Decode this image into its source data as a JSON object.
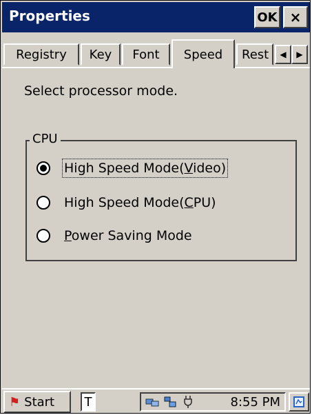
{
  "window": {
    "title": "Properties",
    "ok_label": "OK",
    "close_label": "×"
  },
  "tabs": [
    {
      "label": "Registry"
    },
    {
      "label": "Key"
    },
    {
      "label": "Font"
    },
    {
      "label": "Speed",
      "active": true
    },
    {
      "label": "Rest"
    }
  ],
  "tab_scroll": {
    "left": "◀",
    "right": "▶"
  },
  "content": {
    "instruction": "Select processor mode.",
    "group_label": "CPU",
    "options": [
      {
        "label_before": "High Speed Mode(",
        "mnemonic": "V",
        "label_after": "ideo)",
        "selected": true
      },
      {
        "label_before": "High Speed Mode(",
        "mnemonic": "C",
        "label_after": "PU)",
        "selected": false
      },
      {
        "label_before": "",
        "mnemonic": "P",
        "label_after": "ower Saving Mode",
        "selected": false
      }
    ]
  },
  "taskbar": {
    "start_label": "Start",
    "start_icon": "windows-flag-icon",
    "task_button": "T",
    "tray_icons": [
      "network-icon",
      "sync-icon",
      "power-plug-icon"
    ],
    "time": "8:55 PM",
    "desktop_icon": "desktop-icon"
  }
}
